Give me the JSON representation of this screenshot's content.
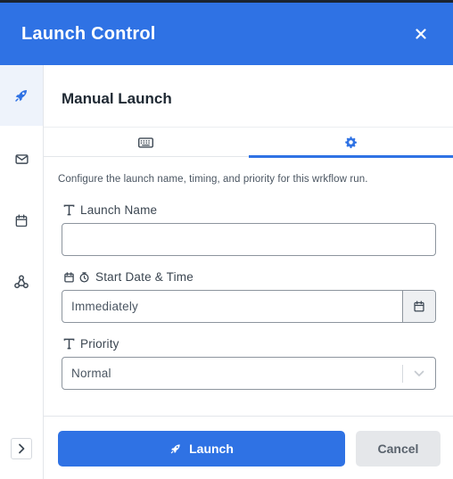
{
  "window": {
    "title": "Launch Control",
    "close_icon": "close-icon"
  },
  "sidebar": {
    "items": [
      {
        "icon": "rocket-icon",
        "active": true
      },
      {
        "icon": "envelope-icon",
        "active": false
      },
      {
        "icon": "calendar-icon",
        "active": false
      },
      {
        "icon": "webhook-icon",
        "active": false
      }
    ],
    "expand_icon": "chevron-right-icon"
  },
  "panel": {
    "title": "Manual Launch",
    "tabs": [
      {
        "icon": "keyboard-icon",
        "active": false
      },
      {
        "icon": "gear-icon",
        "active": true
      }
    ],
    "description": "Configure the launch name, timing, and priority for this wrkflow run."
  },
  "form": {
    "launch_name": {
      "label": "Launch Name",
      "icon": "text-type-icon",
      "value": "",
      "placeholder": ""
    },
    "start": {
      "label": "Start Date & Time",
      "icons": [
        "calendar-icon",
        "clock-icon"
      ],
      "value": "Immediately"
    },
    "priority": {
      "label": "Priority",
      "icon": "text-type-icon",
      "value": "Normal"
    }
  },
  "actions": {
    "launch_label": "Launch",
    "cancel_label": "Cancel"
  },
  "colors": {
    "accent": "#2f72e4",
    "header_bg": "#2f72e4",
    "cancel_bg": "#e5e7ea"
  }
}
